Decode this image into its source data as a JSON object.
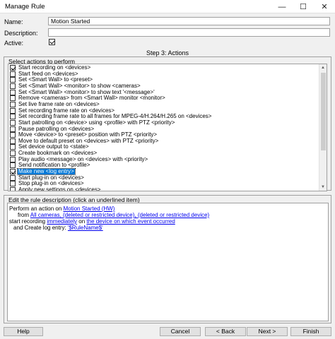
{
  "window": {
    "title": "Manage Rule"
  },
  "form": {
    "name_label": "Name:",
    "name_value": "Motion Started",
    "description_label": "Description:",
    "description_value": "",
    "active_label": "Active:",
    "active_checked": true
  },
  "step_title": "Step 3: Actions",
  "actions": {
    "heading": "Select actions to perform",
    "items": [
      {
        "label": "Start recording on <devices>",
        "checked": true,
        "selected": false
      },
      {
        "label": "Start feed on <devices>",
        "checked": false,
        "selected": false
      },
      {
        "label": "Set <Smart Wall> to <preset>",
        "checked": false,
        "selected": false
      },
      {
        "label": "Set <Smart Wall> <monitor> to show <cameras>",
        "checked": false,
        "selected": false
      },
      {
        "label": "Set <Smart Wall> <monitor> to show text '<message>'",
        "checked": false,
        "selected": false
      },
      {
        "label": "Remove <cameras> from <Smart Wall> monitor <monitor>",
        "checked": false,
        "selected": false
      },
      {
        "label": "Set live frame rate on <devices>",
        "checked": false,
        "selected": false
      },
      {
        "label": "Set recording frame rate on <devices>",
        "checked": false,
        "selected": false
      },
      {
        "label": "Set recording frame rate to all frames for MPEG-4/H.264/H.265 on <devices>",
        "checked": false,
        "selected": false
      },
      {
        "label": "Start patrolling on <device> using <profile> with PTZ <priority>",
        "checked": false,
        "selected": false
      },
      {
        "label": "Pause patrolling on <devices>",
        "checked": false,
        "selected": false
      },
      {
        "label": "Move <device> to <preset> position with PTZ <priority>",
        "checked": false,
        "selected": false
      },
      {
        "label": "Move to default preset on <devices> with PTZ <priority>",
        "checked": false,
        "selected": false
      },
      {
        "label": "Set device output to <state>",
        "checked": false,
        "selected": false
      },
      {
        "label": "Create bookmark on <devices>",
        "checked": false,
        "selected": false
      },
      {
        "label": "Play audio <message> on <devices> with <priority>",
        "checked": false,
        "selected": false
      },
      {
        "label": "Send notification to <profile>",
        "checked": false,
        "selected": false
      },
      {
        "label": "Make new <log entry>",
        "checked": true,
        "selected": true
      },
      {
        "label": "Start plug-in on <devices>",
        "checked": false,
        "selected": false
      },
      {
        "label": "Stop plug-in on <devices>",
        "checked": false,
        "selected": false
      },
      {
        "label": "Apply new settings on <devices>",
        "checked": false,
        "selected": false
      }
    ]
  },
  "rule_description": {
    "heading": "Edit the rule description (click an underlined item)",
    "line1_prefix": "Perform an action on ",
    "line1_link": "Motion Started (HW)",
    "line2_prefix": "from ",
    "line2_link": "All cameras, (deleted or restricted device), (deleted or restricted device)",
    "line3_prefix": "start recording ",
    "line3_link1": "immediately",
    "line3_mid": " on ",
    "line3_link2": "the device on which event occurred",
    "line4_prefix": "and Create log entry: ",
    "line4_link": "'$RuleName$'"
  },
  "buttons": {
    "help": "Help",
    "cancel": "Cancel",
    "back": "< Back",
    "next": "Next >",
    "finish": "Finish"
  }
}
